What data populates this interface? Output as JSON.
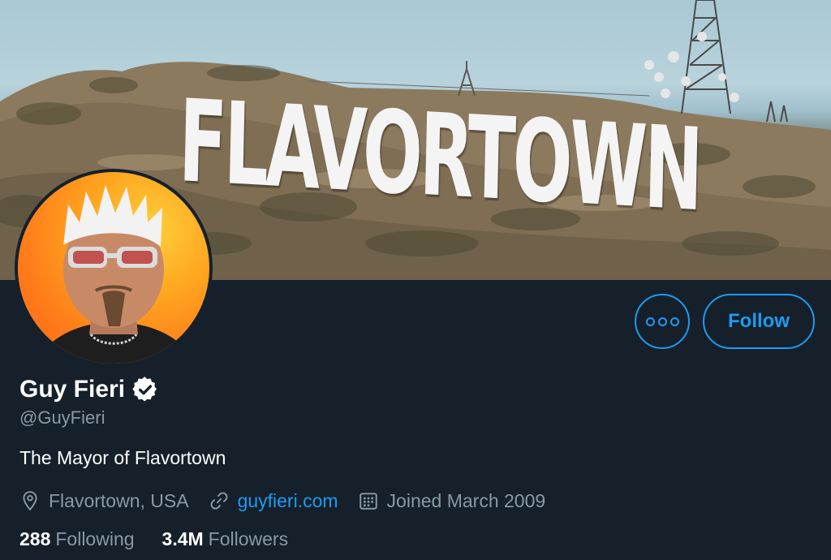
{
  "banner": {
    "sign_text": "FLAVORTOWN"
  },
  "profile": {
    "name": "Guy Fieri",
    "handle": "@GuyFieri",
    "bio": "The Mayor of Flavortown",
    "location": "Flavortown, USA",
    "website": "guyfieri.com",
    "joined": "Joined March 2009",
    "following_count": "288",
    "following_label": "Following",
    "followers_count": "3.4M",
    "followers_label": "Followers",
    "verified": true
  },
  "actions": {
    "follow_label": "Follow"
  },
  "icons": {
    "more": "more-icon",
    "verified": "verified-badge-icon",
    "location": "location-pin-icon",
    "link": "link-icon",
    "calendar": "calendar-icon"
  },
  "colors": {
    "background": "#15202b",
    "accent": "#1d9bf0",
    "secondary_text": "#8899a6",
    "primary_text": "#ffffff"
  }
}
